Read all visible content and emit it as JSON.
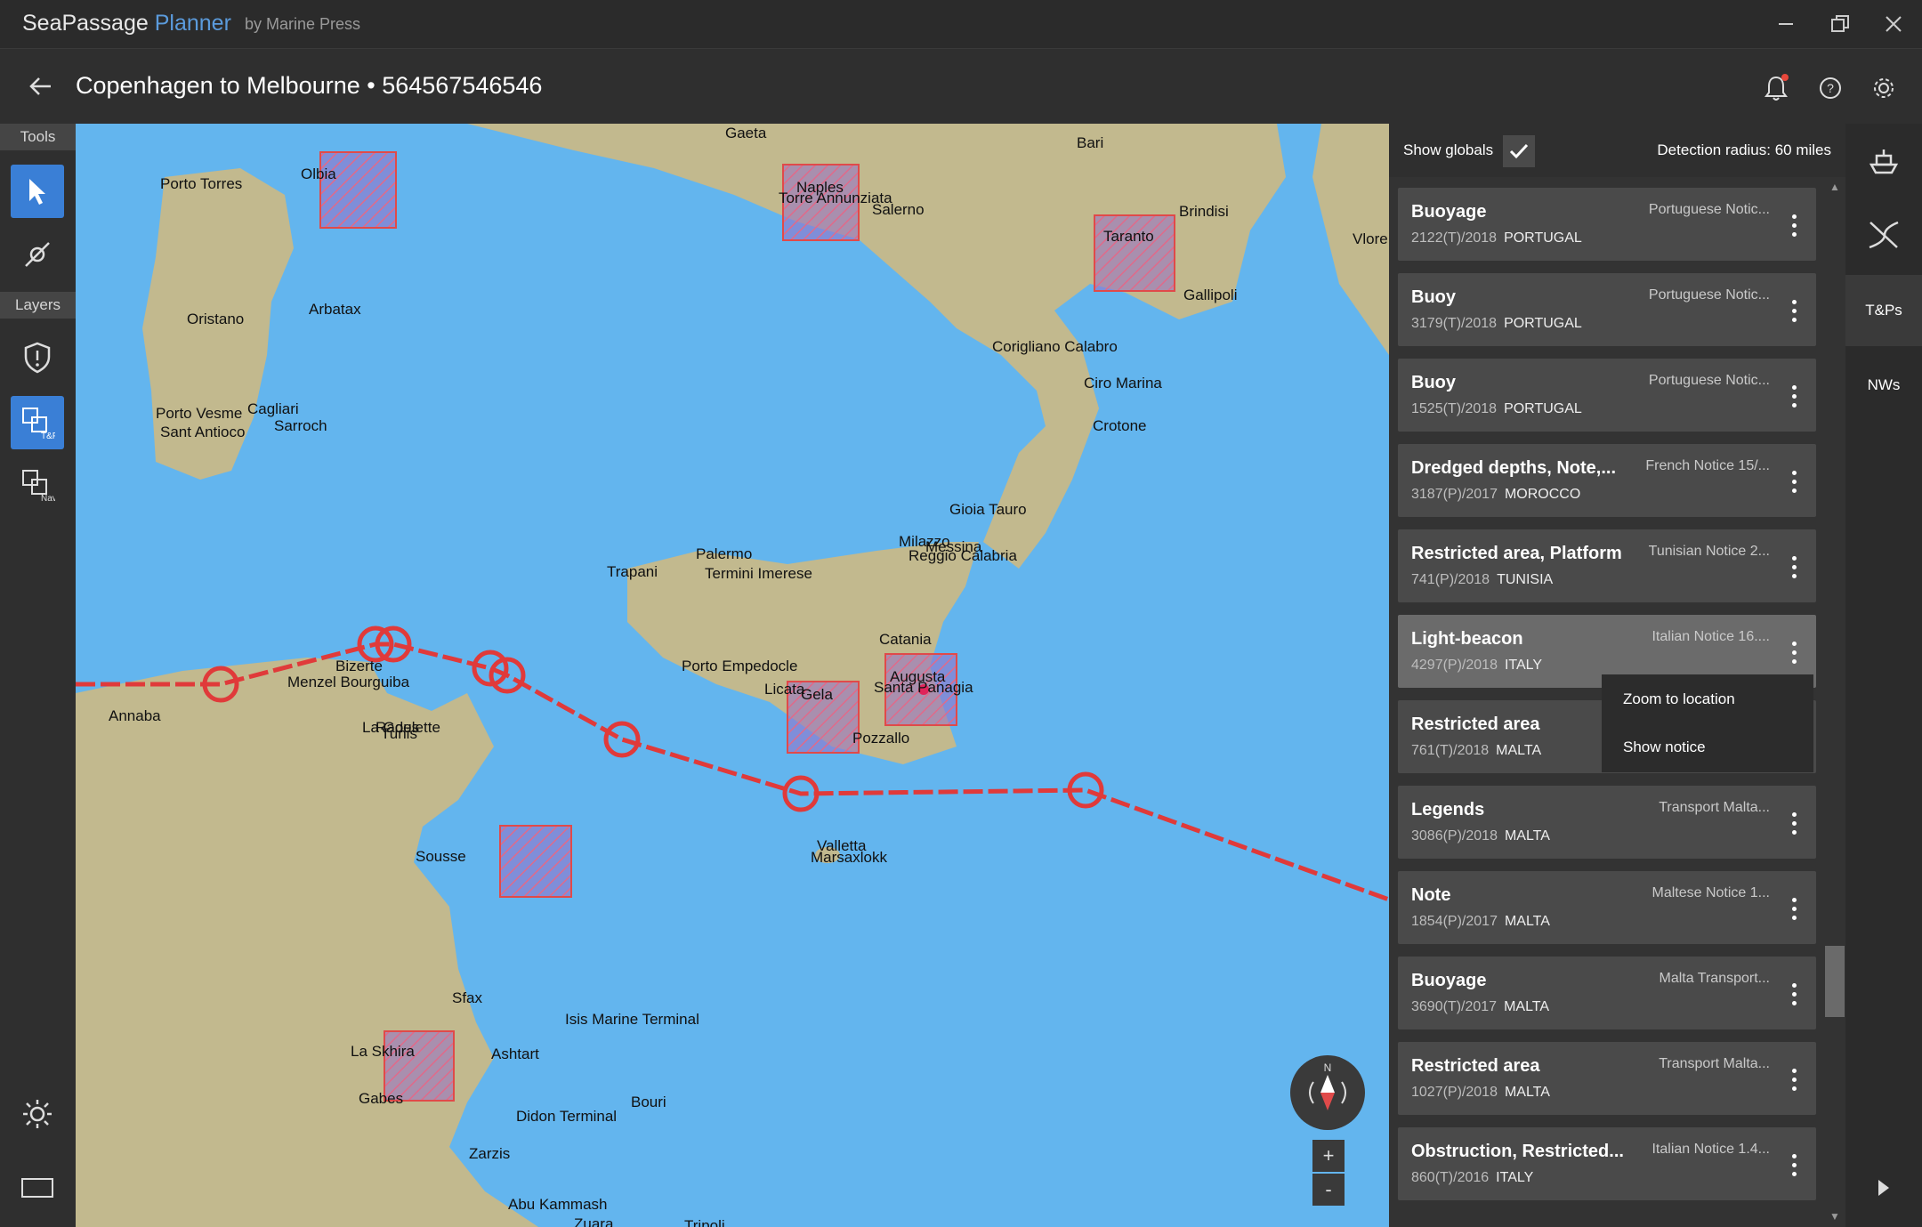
{
  "app": {
    "name_main": "SeaPassage",
    "name_accent": "Planner",
    "by": "by Marine Press"
  },
  "header": {
    "title": "Copenhagen to Melbourne",
    "separator": "•",
    "route_id": "564567546546"
  },
  "toolbar": {
    "tools_label": "Tools",
    "layers_label": "Layers"
  },
  "map": {
    "places": [
      "Gaeta",
      "Bari",
      "Porto Torres",
      "Olbia",
      "Naples",
      "Torre Annunziata",
      "Salerno",
      "Brindisi",
      "Taranto",
      "Gallipoli",
      "Oristano",
      "Arbatax",
      "Porto Vesme",
      "Cagliari",
      "Sant Antioco",
      "Sarroch",
      "Corigliano Calabro",
      "Ciro Marina",
      "Crotone",
      "Gioia Tauro",
      "Milazzo",
      "Messina",
      "Reggio Calabria",
      "Palermo",
      "Trapani",
      "Termini Imerese",
      "Catania",
      "Porto Empedocle",
      "Licata",
      "Gela",
      "Augusta",
      "Santa Panagia",
      "Pozzallo",
      "Bizerte",
      "Menzel Bourguiba",
      "Annaba",
      "La Goulette",
      "Tunis",
      "Rades",
      "Valletta",
      "Marsaxlokk",
      "Sousse",
      "Sfax",
      "Isis Marine Terminal",
      "La Skhira",
      "Ashtart",
      "Gabes",
      "Didon Terminal",
      "Bouri",
      "Zarzis",
      "Abu Kammash",
      "Zuara",
      "Tripoli",
      "Vlore"
    ],
    "compass_n": "N",
    "zoom_in": "+",
    "zoom_out": "-"
  },
  "panel": {
    "show_globals": "Show globals",
    "detection_radius": "Detection radius: 60 miles",
    "notices": [
      {
        "title": "Buoyage",
        "source": "Portuguese Notic...",
        "number": "2122(T)/2018",
        "country": "PORTUGAL"
      },
      {
        "title": "Buoy",
        "source": "Portuguese Notic...",
        "number": "3179(T)/2018",
        "country": "PORTUGAL"
      },
      {
        "title": "Buoy",
        "source": "Portuguese Notic...",
        "number": "1525(T)/2018",
        "country": "PORTUGAL"
      },
      {
        "title": "Dredged depths, Note,...",
        "source": "French Notice 15/...",
        "number": "3187(P)/2017",
        "country": "MOROCCO"
      },
      {
        "title": "Restricted area, Platform",
        "source": "Tunisian Notice 2...",
        "number": "741(P)/2018",
        "country": "TUNISIA"
      },
      {
        "title": "Light-beacon",
        "source": "Italian Notice 16....",
        "number": "4297(P)/2018",
        "country": "ITALY"
      },
      {
        "title": "Restricted area",
        "source": "",
        "number": "761(T)/2018",
        "country": "MALTA"
      },
      {
        "title": "Legends",
        "source": "Transport Malta...",
        "number": "3086(P)/2018",
        "country": "MALTA"
      },
      {
        "title": "Note",
        "source": "Maltese Notice 1...",
        "number": "1854(P)/2017",
        "country": "MALTA"
      },
      {
        "title": "Buoyage",
        "source": "Malta Transport...",
        "number": "3690(T)/2017",
        "country": "MALTA"
      },
      {
        "title": "Restricted area",
        "source": "Transport Malta...",
        "number": "1027(P)/2018",
        "country": "MALTA"
      },
      {
        "title": "Obstruction, Restricted...",
        "source": "Italian Notice 1.4...",
        "number": "860(T)/2016",
        "country": "ITALY"
      }
    ],
    "context_menu": {
      "zoom": "Zoom to location",
      "show": "Show notice"
    }
  },
  "farright": {
    "tp": "T&Ps",
    "nw": "NWs"
  },
  "colors": {
    "sea": "#63b5ee",
    "land": "#c2b98e",
    "route": "#e03a3a",
    "accent": "#3a7fd6"
  }
}
